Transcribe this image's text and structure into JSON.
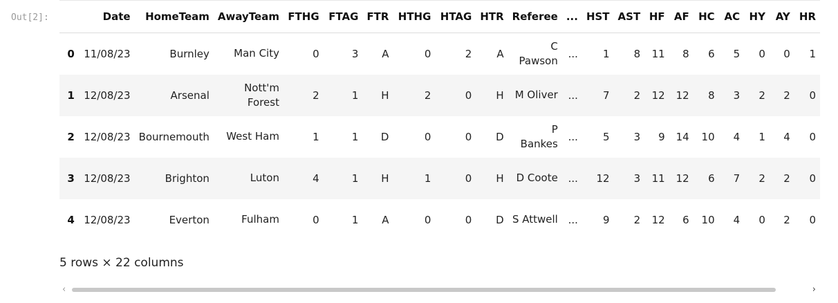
{
  "prompt": "Out[2]:",
  "table": {
    "columns": [
      "",
      "Date",
      "HomeTeam",
      "AwayTeam",
      "FTHG",
      "FTAG",
      "FTR",
      "HTHG",
      "HTAG",
      "HTR",
      "Referee",
      "...",
      "HST",
      "AST",
      "HF",
      "AF",
      "HC",
      "AC",
      "HY",
      "AY",
      "HR"
    ],
    "rows": [
      [
        "0",
        "11/08/23",
        "Burnley",
        "Man City",
        "0",
        "3",
        "A",
        "0",
        "2",
        "A",
        "C Pawson",
        "...",
        "1",
        "8",
        "11",
        "8",
        "6",
        "5",
        "0",
        "0",
        "1"
      ],
      [
        "1",
        "12/08/23",
        "Arsenal",
        "Nott'm Forest",
        "2",
        "1",
        "H",
        "2",
        "0",
        "H",
        "M Oliver",
        "...",
        "7",
        "2",
        "12",
        "12",
        "8",
        "3",
        "2",
        "2",
        "0"
      ],
      [
        "2",
        "12/08/23",
        "Bournemouth",
        "West Ham",
        "1",
        "1",
        "D",
        "0",
        "0",
        "D",
        "P Bankes",
        "...",
        "5",
        "3",
        "9",
        "14",
        "10",
        "4",
        "1",
        "4",
        "0"
      ],
      [
        "3",
        "12/08/23",
        "Brighton",
        "Luton",
        "4",
        "1",
        "H",
        "1",
        "0",
        "H",
        "D Coote",
        "...",
        "12",
        "3",
        "11",
        "12",
        "6",
        "7",
        "2",
        "2",
        "0"
      ],
      [
        "4",
        "12/08/23",
        "Everton",
        "Fulham",
        "0",
        "1",
        "A",
        "0",
        "0",
        "D",
        "S Attwell",
        "...",
        "9",
        "2",
        "12",
        "6",
        "10",
        "4",
        "0",
        "2",
        "0"
      ]
    ]
  },
  "summary": "5 rows × 22 columns",
  "scrollbar": {
    "left_arrow": "‹",
    "right_arrow": "›"
  }
}
